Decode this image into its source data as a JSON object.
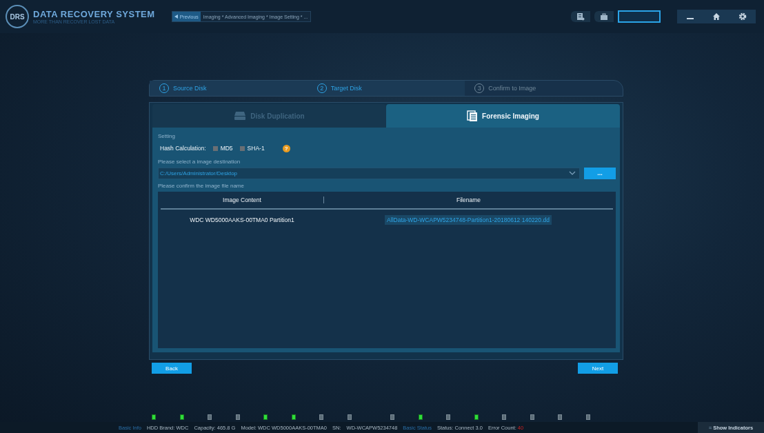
{
  "app": {
    "title": "DATA RECOVERY SYSTEM",
    "subtitle": "MORE THAN RECOVER LOST DATA",
    "logo": "DRS"
  },
  "breadcrumb": {
    "back": "Previous",
    "path": "Imaging * Advanced Imaging * Image Setting * ..."
  },
  "steps": [
    {
      "number": "1",
      "label": "Source Disk",
      "done": true
    },
    {
      "number": "2",
      "label": "Target Disk",
      "done": true
    },
    {
      "number": "3",
      "label": "Confirm to Image",
      "done": false
    }
  ],
  "tabs": [
    {
      "label": "Disk Duplication",
      "kind": "disk",
      "selected": false
    },
    {
      "label": "Forensic Imaging",
      "kind": "document",
      "selected": true
    }
  ],
  "setting": {
    "heading": "Setting",
    "hash_label": "Hash Calculation:",
    "options": [
      {
        "label": "MD5",
        "checked": false
      },
      {
        "label": "SHA-1",
        "checked": false
      }
    ],
    "help": "?"
  },
  "destination": {
    "label": "Please select a image destination",
    "value": "C:/Users/Administrator/Desktop",
    "browse": "..."
  },
  "filename": {
    "label": "Please confirm the image file name",
    "columns": [
      "Image Content",
      "Filename"
    ],
    "rows": [
      {
        "content": "WDC WD5000AAKS-00TMA0 Partition1",
        "filename": "AllData-WD-WCAPW5234748-Partition1-20180612 140220.dd"
      }
    ]
  },
  "buttons": {
    "back": "Back",
    "next": "Next"
  },
  "indicators": [
    {
      "on": true
    },
    {
      "on": true
    },
    {
      "on": false
    },
    {
      "on": false
    },
    {
      "on": true
    },
    {
      "on": true
    },
    {
      "on": false
    },
    {
      "on": false
    },
    {
      "on": false
    },
    {
      "on": true
    },
    {
      "on": false
    },
    {
      "on": true
    },
    {
      "on": false
    },
    {
      "on": false
    },
    {
      "on": false
    },
    {
      "on": false
    }
  ],
  "status_bar": {
    "info_label": "Basic Info",
    "brand": "HDD Brand: WDC",
    "capacity": "Capacity: 465.8 G",
    "model": "Model: WDC WD5000AAKS-00TMA0",
    "sn_label": "SN:",
    "sn": "WD-WCAPW5234748",
    "status_label": "Basic Status",
    "status": "Status: Connect 3.0",
    "error_label": "Error Count:",
    "error_count": "40",
    "toggle_icon": "≈",
    "toggle": "Show Indicators"
  }
}
